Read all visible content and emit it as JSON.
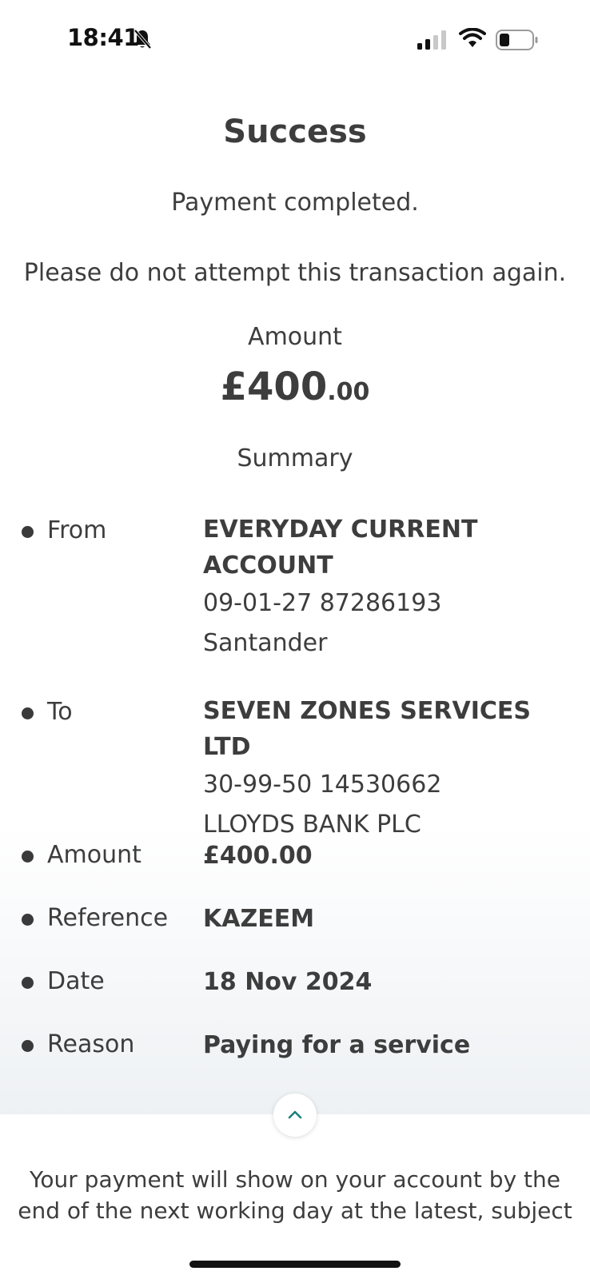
{
  "status_bar": {
    "time": "18:41"
  },
  "header": {
    "title": "Success"
  },
  "messages": {
    "completed": "Payment completed.",
    "warning": "Please do not attempt this transaction again."
  },
  "amount": {
    "label": "Amount",
    "whole": "£400",
    "decimal": ".00"
  },
  "summary": {
    "heading": "Summary",
    "from": {
      "label": "From",
      "account_name_line1": "EVERYDAY CURRENT",
      "account_name_line2": "ACCOUNT",
      "sort_account": "09-01-27 87286193",
      "bank": "Santander"
    },
    "to": {
      "label": "To",
      "payee": "SEVEN ZONES SERVICES LTD",
      "sort_account": "30-99-50 14530662",
      "bank": "LLOYDS BANK PLC"
    },
    "amount": {
      "label": "Amount",
      "value": "£400.00"
    },
    "reference": {
      "label": "Reference",
      "value": "KAZEEM"
    },
    "date": {
      "label": "Date",
      "value": "18 Nov 2024"
    },
    "reason": {
      "label": "Reason",
      "value": "Paying for a service"
    }
  },
  "footer": {
    "line1": "Your payment will show on your account by the",
    "line2": "end of the next working day at the latest, subject"
  },
  "icons": {
    "bell": "bell-slash-icon",
    "signal": "cellular-signal-icon",
    "wifi": "wifi-icon",
    "battery": "battery-icon",
    "collapse": "chevron-up-icon"
  },
  "colors": {
    "accent": "#1a7f7a",
    "text": "#3d3d3d"
  }
}
